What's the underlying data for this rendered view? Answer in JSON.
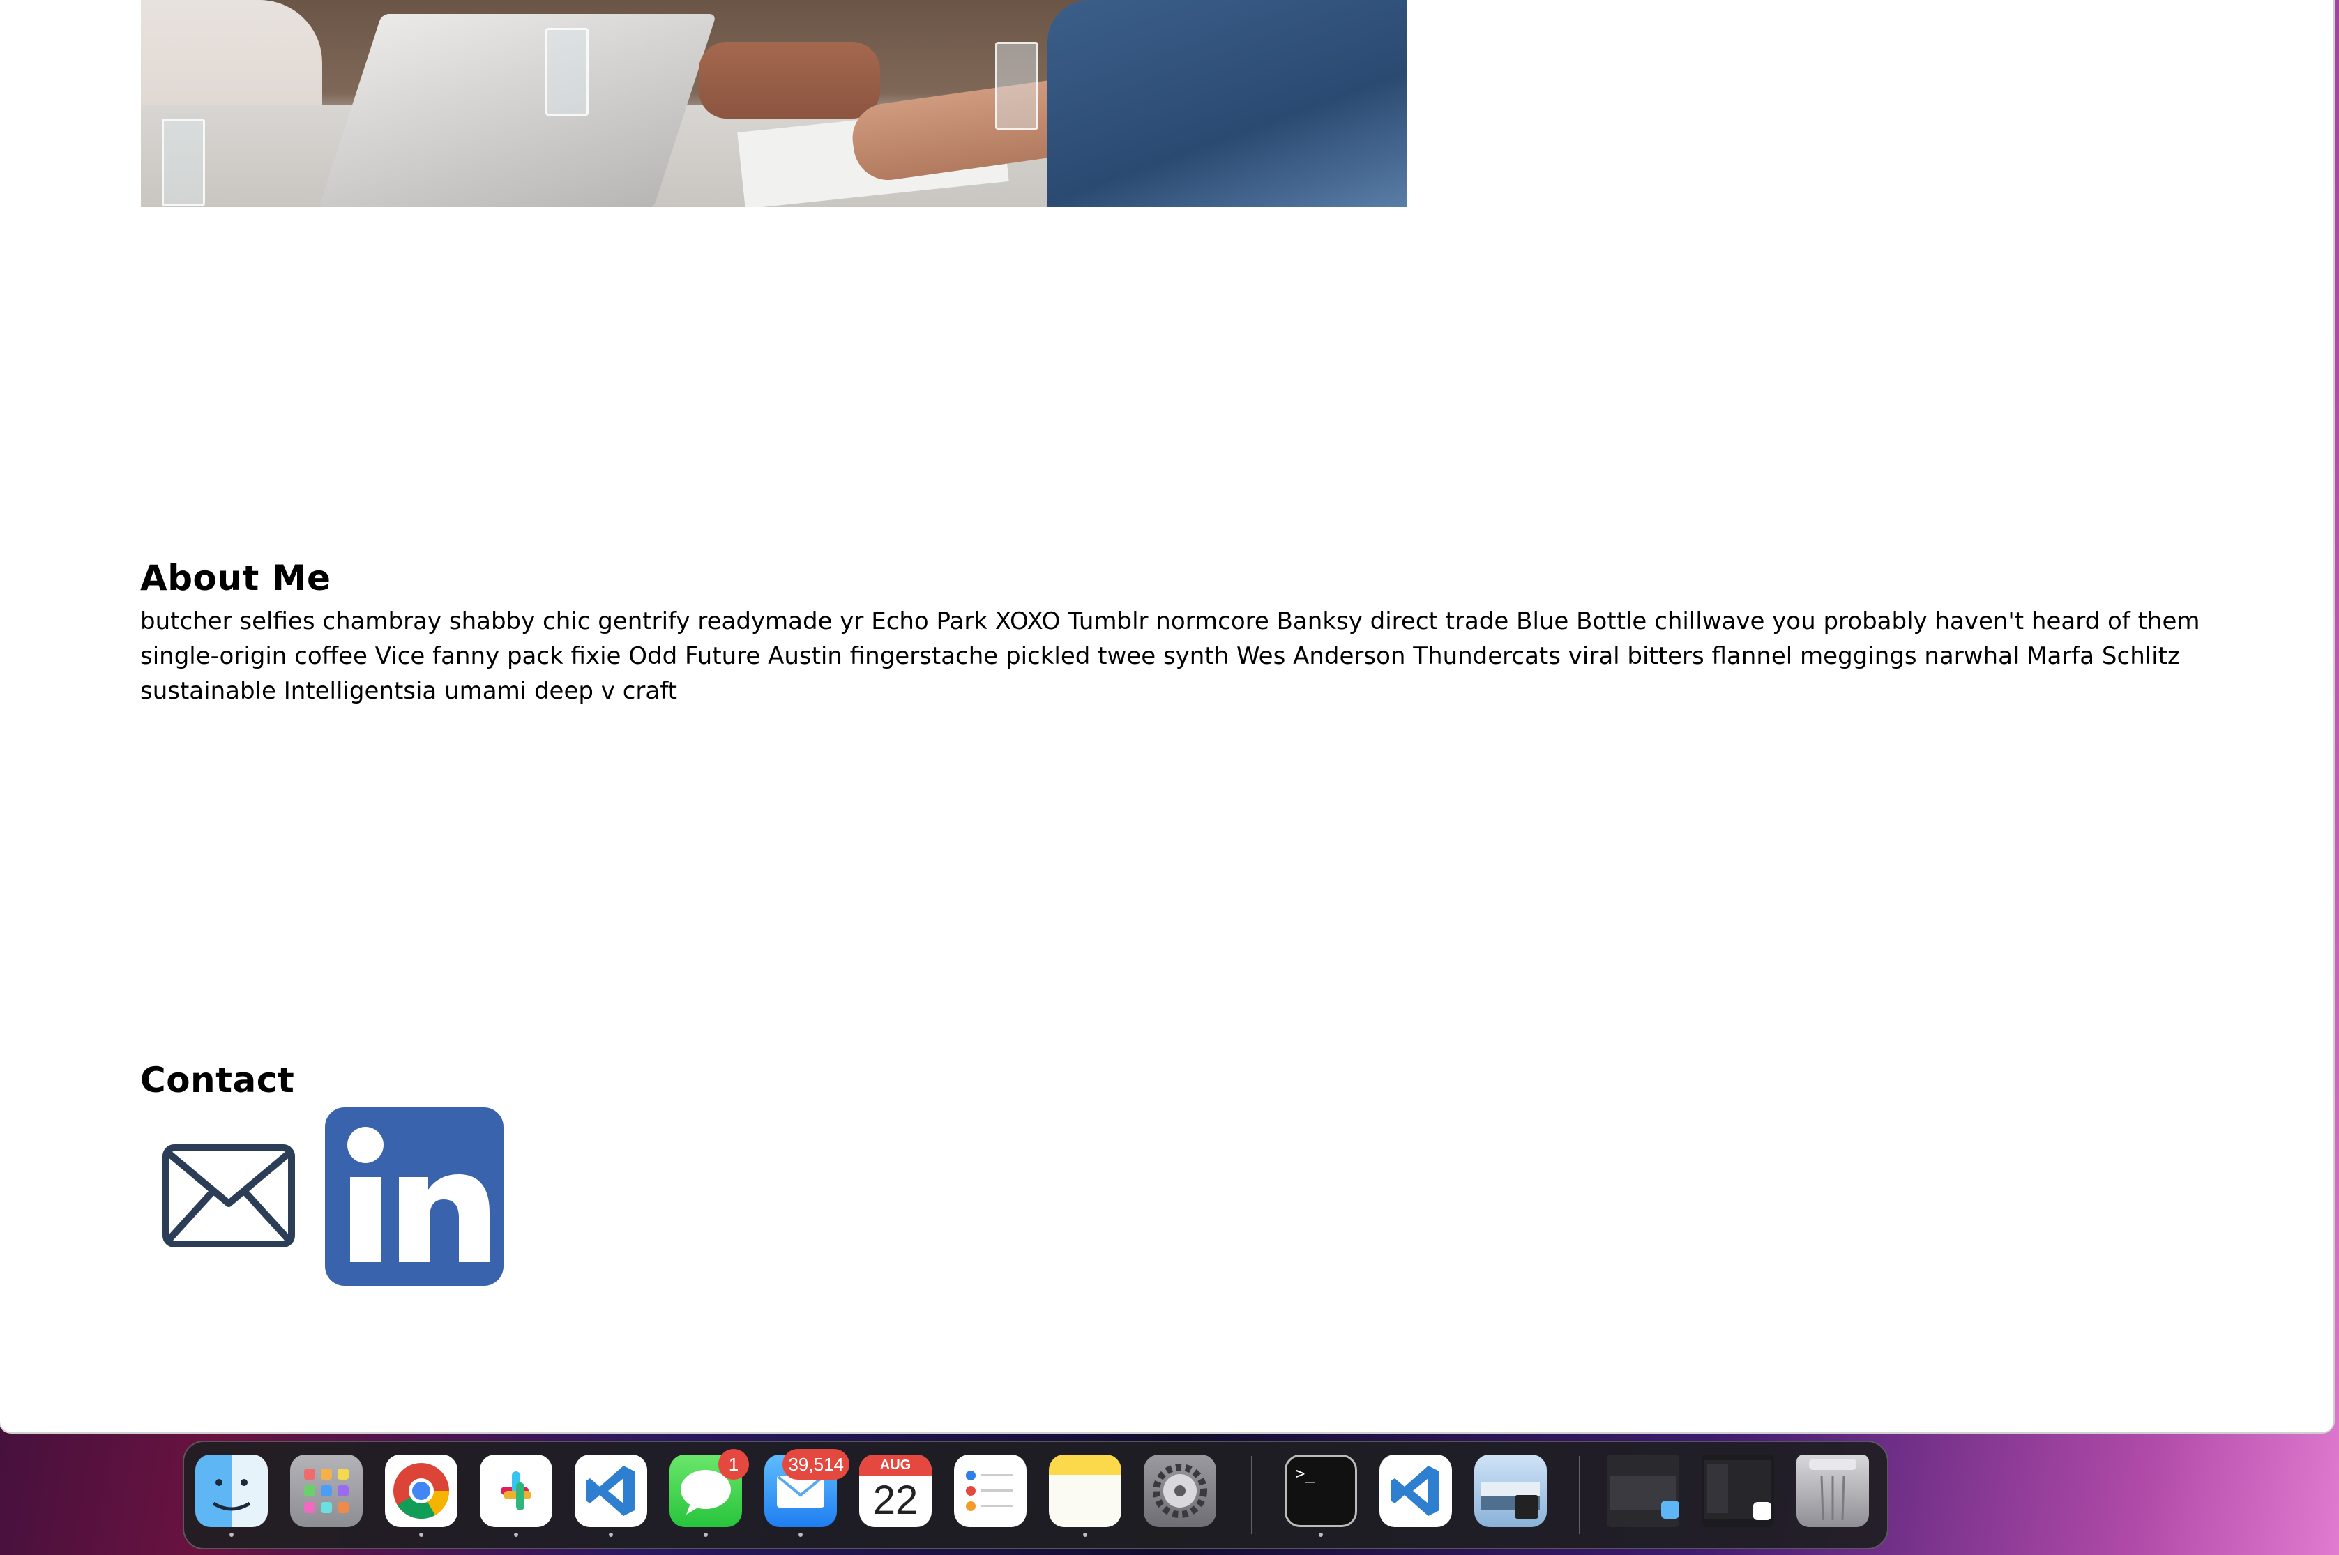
{
  "about": {
    "title": "About Me",
    "text": "butcher selfies chambray shabby chic gentrify readymade yr Echo Park XOXO Tumblr normcore Banksy direct trade Blue Bottle chillwave you probably haven't heard of them single-origin coffee Vice fanny pack fixie Odd Future Austin fingerstache pickled twee synth Wes Anderson Thundercats viral bitters flannel meggings narwhal Marfa Schlitz sustainable Intelligentsia umami deep v craft"
  },
  "contact": {
    "title": "Contact",
    "email_icon": "envelope-icon",
    "linkedin_icon": "linkedin-icon",
    "linkedin_text": "in",
    "colors": {
      "linkedin": "#3a63ad",
      "envelope": "#2c3e57"
    }
  },
  "dock": {
    "items": [
      {
        "name": "finder",
        "icon": "finder-icon"
      },
      {
        "name": "launchpad",
        "icon": "launchpad-icon"
      },
      {
        "name": "chrome",
        "icon": "chrome-icon"
      },
      {
        "name": "slack",
        "icon": "slack-icon"
      },
      {
        "name": "vscode",
        "icon": "vscode-icon"
      },
      {
        "name": "messages",
        "icon": "messages-icon",
        "badge": "1"
      },
      {
        "name": "mail",
        "icon": "mail-icon",
        "badge": "39,514"
      },
      {
        "name": "calendar",
        "icon": "calendar-icon",
        "month": "AUG",
        "day": "22"
      },
      {
        "name": "reminders",
        "icon": "reminders-icon"
      },
      {
        "name": "notes",
        "icon": "notes-icon"
      },
      {
        "name": "system-settings",
        "icon": "gear-icon"
      },
      {
        "name": "terminal",
        "icon": "terminal-icon",
        "prompt": ">_"
      },
      {
        "name": "vscode-2",
        "icon": "vscode-icon"
      },
      {
        "name": "preview",
        "icon": "preview-icon"
      },
      {
        "name": "recent-window-1",
        "icon": "window-thumbnail-icon"
      },
      {
        "name": "recent-window-2",
        "icon": "window-thumbnail-icon"
      },
      {
        "name": "trash",
        "icon": "trash-icon"
      }
    ]
  }
}
